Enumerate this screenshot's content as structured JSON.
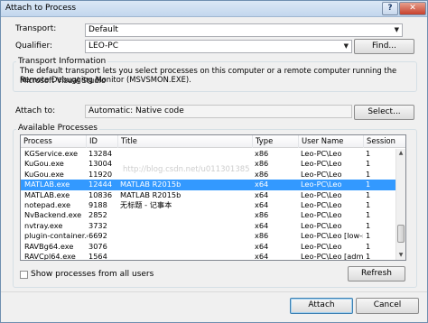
{
  "window": {
    "title": "Attach to Process",
    "help_label": "?",
    "close_label": "✕"
  },
  "transport": {
    "label": "Transport:",
    "value": "Default"
  },
  "qualifier": {
    "label": "Qualifier:",
    "value": "LEO-PC",
    "find_label": "Find..."
  },
  "transport_info": {
    "group_title": "Transport Information",
    "line1": "The default transport lets you select processes on this computer or a remote computer running the Microsoft Visual Studio",
    "line2": "Remote Debugging Monitor (MSVSMON.EXE)."
  },
  "attach_to": {
    "label": "Attach to:",
    "value": "Automatic: Native code",
    "select_label": "Select..."
  },
  "available": {
    "group_title": "Available Processes",
    "columns": [
      "Process",
      "ID",
      "Title",
      "Type",
      "User Name",
      "Session"
    ],
    "rows": [
      {
        "process": "KGService.exe",
        "id": "13284",
        "title": "",
        "type": "x86",
        "user": "Leo-PC\\Leo",
        "session": "1"
      },
      {
        "process": "KuGou.exe",
        "id": "13004",
        "title": "",
        "type": "x86",
        "user": "Leo-PC\\Leo",
        "session": "1"
      },
      {
        "process": "KuGou.exe",
        "id": "11920",
        "title": "",
        "type": "x86",
        "user": "Leo-PC\\Leo",
        "session": "1"
      },
      {
        "process": "MATLAB.exe",
        "id": "12444",
        "title": "MATLAB R2015b",
        "type": "x64",
        "user": "Leo-PC\\Leo",
        "session": "1",
        "selected": true
      },
      {
        "process": "MATLAB.exe",
        "id": "10836",
        "title": "MATLAB R2015b",
        "type": "x64",
        "user": "Leo-PC\\Leo",
        "session": "1"
      },
      {
        "process": "notepad.exe",
        "id": "9188",
        "title": "无标题 - 记事本",
        "type": "x64",
        "user": "Leo-PC\\Leo",
        "session": "1"
      },
      {
        "process": "NvBackend.exe",
        "id": "2852",
        "title": "",
        "type": "x86",
        "user": "Leo-PC\\Leo",
        "session": "1"
      },
      {
        "process": "nvtray.exe",
        "id": "3732",
        "title": "",
        "type": "x64",
        "user": "Leo-PC\\Leo",
        "session": "1"
      },
      {
        "process": "plugin-container.exe",
        "id": "6692",
        "title": "",
        "type": "x86",
        "user": "Leo-PC\\Leo [low-ri...",
        "session": "1"
      },
      {
        "process": "RAVBg64.exe",
        "id": "3076",
        "title": "",
        "type": "x64",
        "user": "Leo-PC\\Leo",
        "session": "1"
      },
      {
        "process": "RAVCpl64.exe",
        "id": "1564",
        "title": "",
        "type": "x64",
        "user": "Leo-PC\\Leo [admin...",
        "session": "1"
      }
    ],
    "show_all_label": "Show processes from all users",
    "refresh_label": "Refresh"
  },
  "watermark": "http://blog.csdn.net/u011301385",
  "footer": {
    "attach_label": "Attach",
    "cancel_label": "Cancel"
  },
  "icons": {
    "scroll_up": "▲",
    "scroll_down": "▼",
    "combo_arrow": "▼"
  }
}
